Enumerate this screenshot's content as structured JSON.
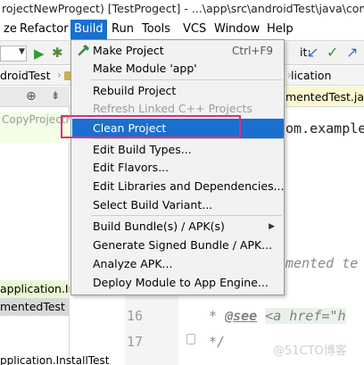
{
  "window": {
    "title": "rojectNewProgect) [TestProgect] - ...\\app\\src\\androidTest\\java\\com\\exa"
  },
  "menubar": {
    "items": [
      "ze",
      "Refactor",
      "Build",
      "Run",
      "Tools",
      "VCS",
      "Window",
      "Help"
    ]
  },
  "toolbar": {
    "combo_arrow": "▼",
    "right_label": "it:"
  },
  "breadcrumbs": {
    "left": "droidTest",
    "right": "lication"
  },
  "left_panel": {
    "faded_text": "CopyProjectN",
    "rows": [
      "application.Ins",
      "mentedTest",
      "pplication.InstallTest"
    ]
  },
  "editor": {
    "tab": "mentedTest.java",
    "code_line": "om.example",
    "lower_comment": "mented te",
    "line_numbers": [
      "16",
      "17"
    ],
    "line16_prefix": "* ",
    "line16_tag": "@see",
    "line16_html": "<a href=\"h",
    "line17": "*/"
  },
  "watermark": "@51CTO博客",
  "build_menu": {
    "items": [
      {
        "label": "Make Project",
        "shortcut": "Ctrl+F9",
        "icon": "hammer-icon"
      },
      {
        "label": "Make Module 'app'"
      },
      {
        "label": "Rebuild Project"
      },
      {
        "label": "Refresh Linked C++ Projects",
        "disabled": true
      },
      {
        "label": "Clean Project",
        "highlighted": true
      },
      {
        "label": "Edit Build Types..."
      },
      {
        "label": "Edit Flavors..."
      },
      {
        "label": "Edit Libraries and Dependencies..."
      },
      {
        "label": "Select Build Variant..."
      },
      {
        "label": "Build Bundle(s) / APK(s)",
        "submenu": true
      },
      {
        "label": "Generate Signed Bundle / APK..."
      },
      {
        "label": "Analyze APK..."
      },
      {
        "label": "Deploy Module to App Engine..."
      }
    ]
  },
  "colors": {
    "highlight": "#1a6fcf",
    "annotation": "#d63384"
  }
}
